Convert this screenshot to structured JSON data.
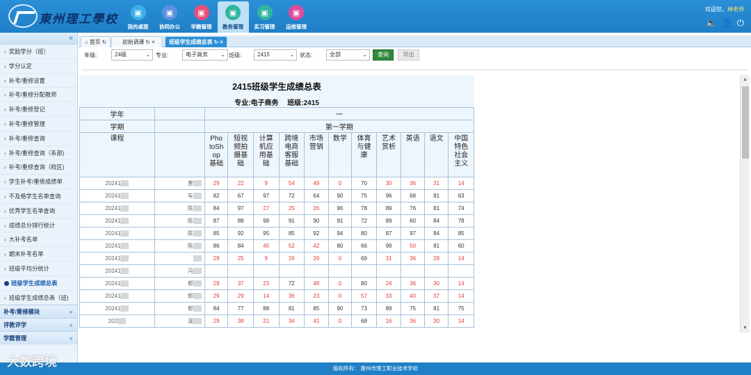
{
  "header": {
    "logo_text": "東州理工學校",
    "nav": [
      {
        "label": "我的桌面",
        "icon": "monitor-icon",
        "color": "#3bb0e8"
      },
      {
        "label": "协同办公",
        "icon": "grid-icon",
        "color": "#5b8fe0"
      },
      {
        "label": "学籍管理",
        "icon": "printer-icon",
        "color": "#e84f7b"
      },
      {
        "label": "教务管理",
        "icon": "image-icon",
        "color": "#2fb5a0"
      },
      {
        "label": "实习管理",
        "icon": "flask-icon",
        "color": "#2fb5a0"
      },
      {
        "label": "运维管理",
        "icon": "tools-icon",
        "color": "#e04a9c"
      }
    ],
    "welcome": "欢迎您，",
    "username": "林老师"
  },
  "sidebar": {
    "items": [
      "奖励学分（班）",
      "学分认定",
      "补考/重修设置",
      "补考/重修分配教师",
      "补考/重修登记",
      "补考/重修管理",
      "补考/重修查询",
      "补考/重修查询（系部)",
      "补考/重修查询（校区)",
      "学生补考/重修成绩单",
      "不及格学生名单查询",
      "优秀学生名单查询",
      "成绩总分排行统计",
      "大补考名单",
      "期末补考名单",
      "班级平均分统计",
      "班级学生成绩总表",
      "班级学生成绩总表（班)"
    ],
    "active_index": 16,
    "sections": [
      "补考/重修模块",
      "评教评学",
      "学籍管理"
    ]
  },
  "tabs": [
    "首页",
    "初始调课",
    "班级学生成绩总表"
  ],
  "filters": {
    "grade_label": "年级:",
    "grade_value": "24级",
    "major_label": "专业:",
    "major_value": "电子商务",
    "class_label": "班级:",
    "class_value": "2415",
    "status_label": "状态:",
    "status_value": "全部",
    "query_label": "查询",
    "export_label": "导出"
  },
  "report": {
    "title": "2415班级学生成绩总表",
    "major_text": "专业:电子商务",
    "class_text": "班级:2415",
    "row_year": "学年",
    "year_value": "一",
    "row_term": "学期",
    "term_value": "第一学期",
    "row_course": "课程",
    "courses": [
      "PhotoShop基础",
      "短视频拍摄基础",
      "计算机应用基础",
      "跨境电商客服基础",
      "市场营销",
      "数学",
      "体育与健康",
      "艺术赏析",
      "英语",
      "语文",
      "中国特色社会主义"
    ],
    "course_lines": [
      [
        "Pho",
        "toSh",
        "op",
        "基础"
      ],
      [
        "短视",
        "频拍",
        "摄基",
        "础"
      ],
      [
        "计算",
        "机应",
        "用基",
        "础"
      ],
      [
        "跨境",
        "电商",
        "客服",
        "基础"
      ],
      [
        "市场",
        "营销"
      ],
      [
        "数学"
      ],
      [
        "体育",
        "与健",
        "康"
      ],
      [
        "艺术",
        "赏析"
      ],
      [
        "英语"
      ],
      [
        "语文"
      ],
      [
        "中国",
        "特色",
        "社会",
        "主义"
      ]
    ],
    "rows": [
      {
        "id": "20241",
        "name": "曾",
        "scores": [
          "29",
          "22",
          "9",
          "54",
          "49",
          "0",
          "70",
          "30",
          "36",
          "31",
          "14"
        ]
      },
      {
        "id": "20241",
        "name": "车",
        "scores": [
          "82",
          "67",
          "97",
          "72",
          "64",
          "90",
          "75",
          "96",
          "68",
          "81",
          "63"
        ]
      },
      {
        "id": "20241",
        "name": "陈",
        "scores": [
          "84",
          "97",
          "27",
          "25",
          "26",
          "96",
          "78",
          "89",
          "76",
          "81",
          "74"
        ]
      },
      {
        "id": "20241",
        "name": "陈",
        "scores": [
          "87",
          "88",
          "98",
          "91",
          "90",
          "91",
          "72",
          "89",
          "60",
          "84",
          "78"
        ]
      },
      {
        "id": "20241",
        "name": "陈",
        "scores": [
          "85",
          "92",
          "95",
          "85",
          "92",
          "94",
          "80",
          "87",
          "97",
          "84",
          "85"
        ]
      },
      {
        "id": "20241",
        "name": "陈",
        "scores": [
          "86",
          "84",
          "45",
          "52",
          "42",
          "80",
          "66",
          "99",
          "50",
          "81",
          "60"
        ]
      },
      {
        "id": "20241",
        "name": "",
        "scores": [
          "29",
          "25",
          "9",
          "26",
          "26",
          "0",
          "69",
          "31",
          "36",
          "28",
          "14"
        ]
      },
      {
        "id": "20241",
        "name": "冯",
        "scores": [
          "",
          "",
          "",
          "",
          "",
          "",
          "",
          "",
          "",
          "",
          ""
        ]
      },
      {
        "id": "20241",
        "name": "郭",
        "scores": [
          "29",
          "37",
          "23",
          "72",
          "48",
          "0",
          "80",
          "24",
          "36",
          "30",
          "14"
        ]
      },
      {
        "id": "20241",
        "name": "郭",
        "scores": [
          "29",
          "29",
          "14",
          "36",
          "23",
          "0",
          "57",
          "33",
          "40",
          "37",
          "14"
        ]
      },
      {
        "id": "20241",
        "name": "郭",
        "scores": [
          "84",
          "77",
          "88",
          "81",
          "85",
          "90",
          "73",
          "89",
          "75",
          "81",
          "75"
        ]
      },
      {
        "id": "202",
        "name": "温",
        "scores": [
          "29",
          "38",
          "21",
          "34",
          "41",
          "0",
          "68",
          "16",
          "36",
          "30",
          "14"
        ]
      }
    ],
    "fail_color": "#e23a3a"
  },
  "footer": {
    "copyright": "版权所有： 惠州市理工职业技术学校"
  },
  "watermark": "大数跨境"
}
